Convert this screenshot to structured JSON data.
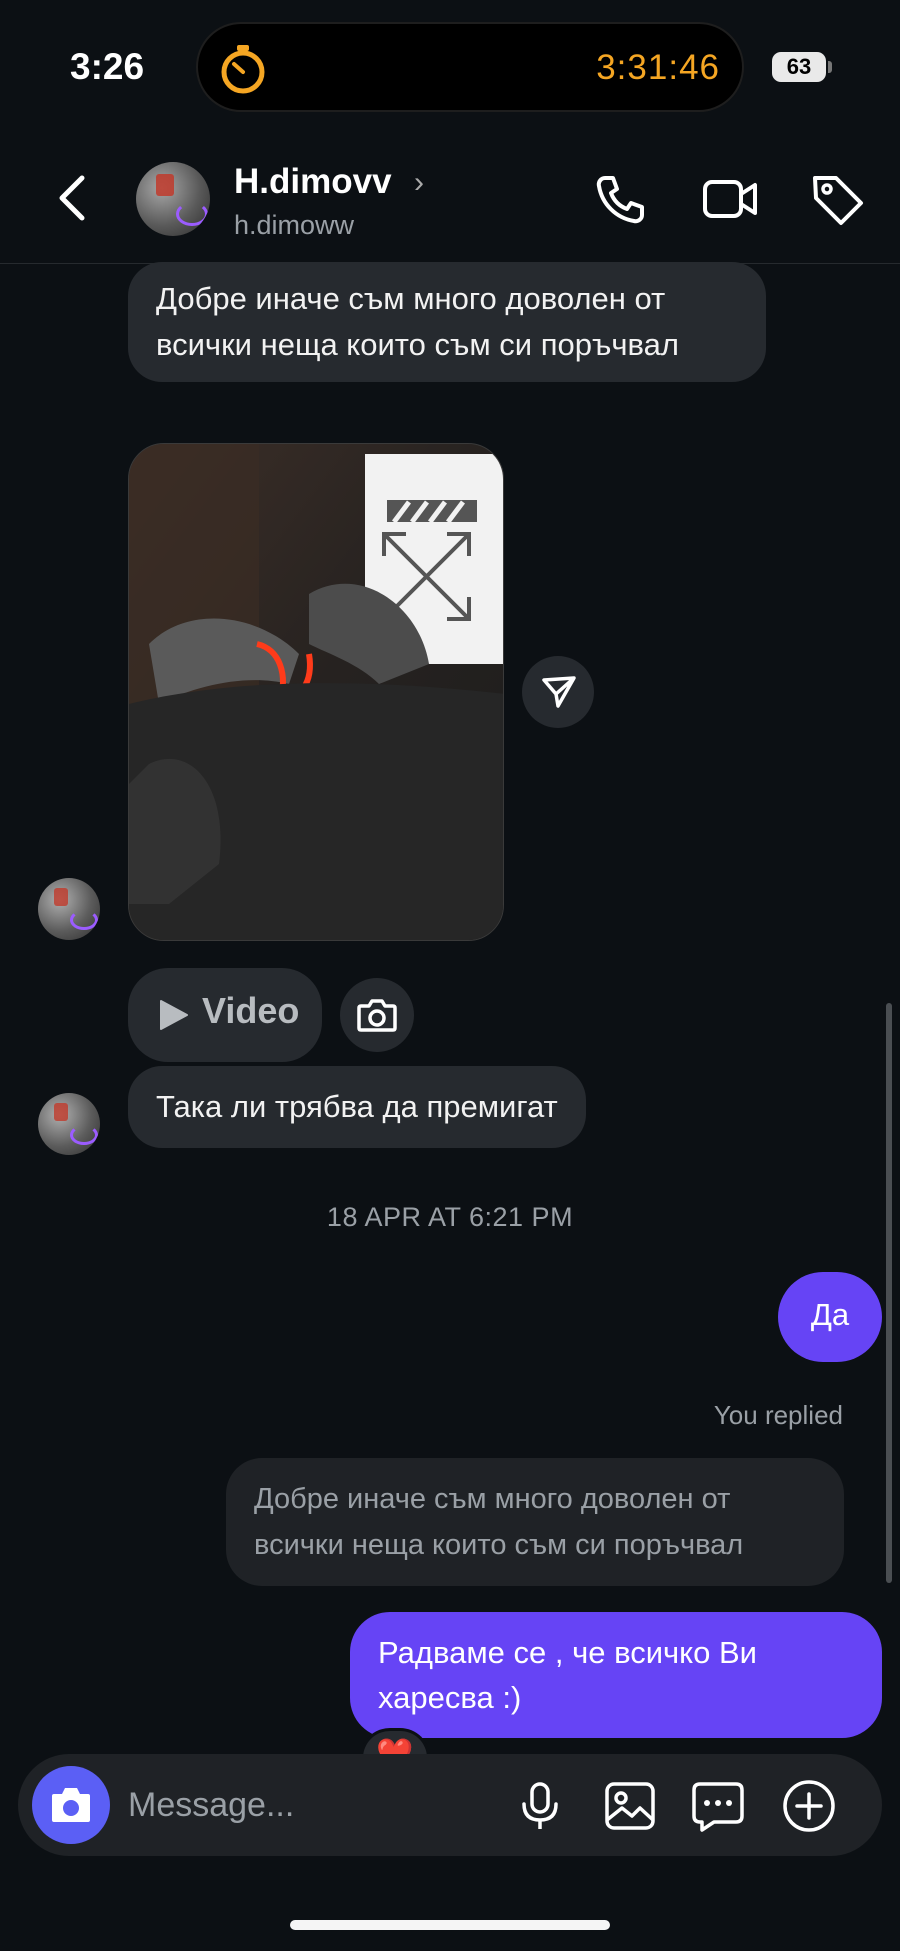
{
  "status_bar": {
    "time": "3:26",
    "timer": "3:31:46",
    "battery": "63"
  },
  "header": {
    "name": "H.dimovv",
    "handle": "h.dimoww",
    "icons": [
      "back-chevron-icon",
      "phone-icon",
      "video-camera-icon",
      "tag-icon"
    ]
  },
  "messages": {
    "incoming_1": "Добре иначе съм много доволен от всички неща които съм си поръчвал",
    "video_label": "Video",
    "incoming_2": "Така ли трябва да премигат",
    "timestamp": "18 APR AT 6:21 PM",
    "outgoing_1": "Да",
    "you_replied": "You replied",
    "reply_quote": "Добре иначе съм много доволен от всички неща които съм си поръчвал",
    "outgoing_2": "Радваме се  , че всичко Ви харесва :)",
    "reaction": "❤️"
  },
  "composer": {
    "placeholder": "Message..."
  },
  "colors": {
    "background": "#0c1014",
    "incoming_bubble": "#262a2f",
    "outgoing_bubble": "#6644f5",
    "timer": "#f5a623",
    "camera_button": "#5b5ff5"
  }
}
